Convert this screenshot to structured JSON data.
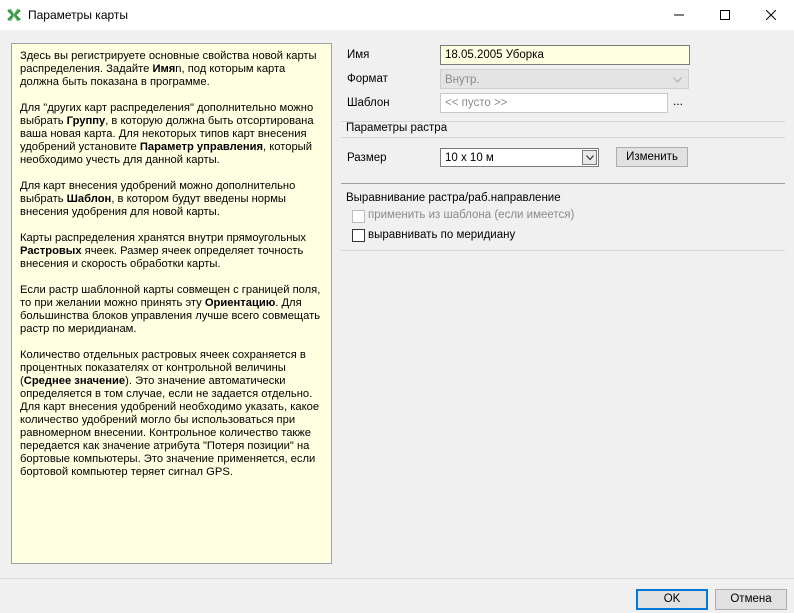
{
  "window": {
    "title": "Параметры карты"
  },
  "help": {
    "p1": {
      "a": "Здесь вы регистрируете основные свойства новой карты распределения. Задайте ",
      "b": "Имя",
      "c": "n, под которым карта должна быть показана в программе."
    },
    "p2": {
      "a": "Для \"других карт распределения\" дополнительно можно выбрать ",
      "b": "Группу",
      "c": ", в которую должна быть отсортирована ваша новая карта. Для некоторых типов карт внесения удобрений установите ",
      "d": "Параметр управления",
      "e": ", который необходимо учесть для данной карты."
    },
    "p3": {
      "a": "Для карт внесения удобрений можно дополнительно выбрать ",
      "b": "Шаблон",
      "c": ", в котором будут введены нормы внесения удобрения для новой карты."
    },
    "p4": {
      "a": "Карты распределения хранятся внутри прямоугольных ",
      "b": "Растровых",
      "c": " ячеек. Размер ячеек определяет точность внесения и скорость обработки карты."
    },
    "p5": {
      "a": "Если растр шаблонной карты совмещен с границей поля, то при желании можно принять эту ",
      "b": "Ориентацию",
      "c": ". Для большинства блоков управления лучше всего совмещать растр по меридианам."
    },
    "p6": {
      "a": "Количество отдельных растровых ячеек сохраняется в процентных показателях от контрольной величины (",
      "b": "Среднее значение",
      "c": "). Это значение автоматически определяется в том случае, если не задается отдельно. Для карт внесения удобрений необходимо указать, какое количество удобрений могло бы использоваться при равномерном внесении. Контрольное количество также передается как значение атрибута \"Потеря позиции\" на бортовые компьютеры. Это значение применяется, если бортовой компьютер теряет сигнал GPS."
    }
  },
  "form": {
    "name_label": "Имя",
    "name_value": "18.05.2005 Уборка",
    "format_label": "Формат",
    "format_value": "Внутр.",
    "template_label": "Шаблон",
    "template_placeholder": "<< пусто >>",
    "template_browse": "..."
  },
  "raster": {
    "group_title": "Параметры растра",
    "size_label": "Размер",
    "size_value": "10 x 10 м",
    "change_button": "Изменить"
  },
  "alignment": {
    "title": "Выравнивание растра/раб.направление",
    "from_template": "применить из шаблона (если имеется)",
    "from_template_checked": false,
    "meridian": "выравнивать по меридиану",
    "meridian_checked": false
  },
  "footer": {
    "ok": "OK",
    "cancel": "Отмена"
  },
  "colors": {
    "help_background": "#ffffe1",
    "accent": "#0078d7",
    "app_icon": "#2e8b3a"
  }
}
